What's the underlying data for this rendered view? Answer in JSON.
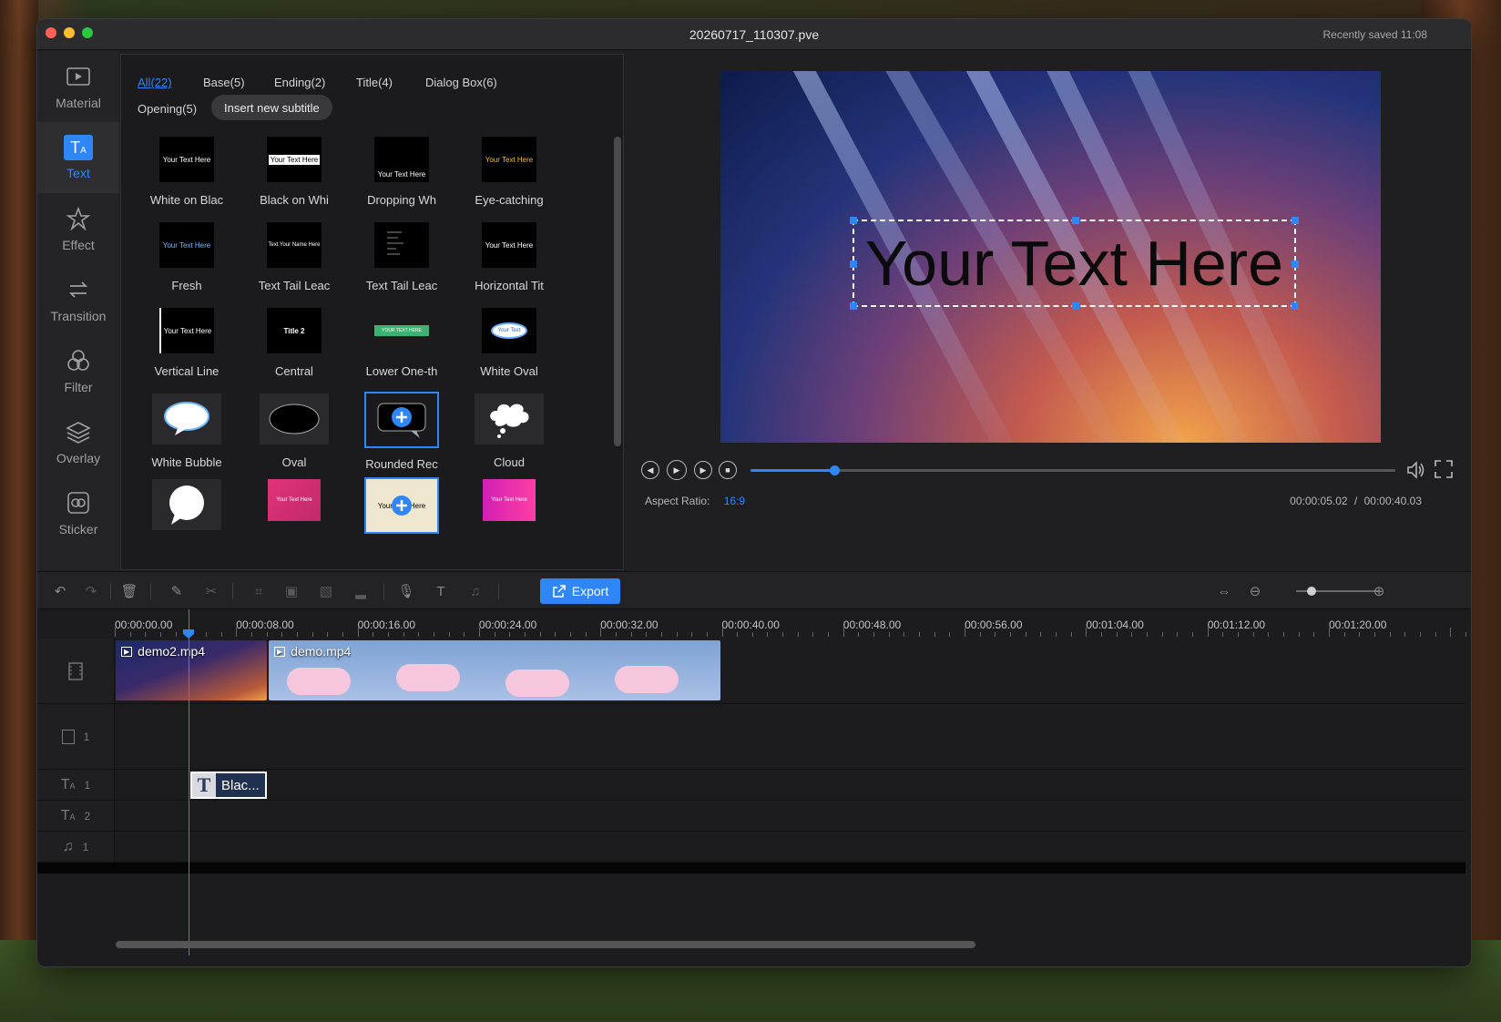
{
  "window": {
    "title": "20260717_110307.pve",
    "saved_text": "Recently saved  11:08"
  },
  "nav": [
    {
      "label": "Material",
      "icon": "material-icon"
    },
    {
      "label": "Text",
      "icon": "text-icon",
      "active": true
    },
    {
      "label": "Effect",
      "icon": "effect-icon"
    },
    {
      "label": "Transition",
      "icon": "transition-icon"
    },
    {
      "label": "Filter",
      "icon": "filter-icon"
    },
    {
      "label": "Overlay",
      "icon": "overlay-icon"
    },
    {
      "label": "Sticker",
      "icon": "sticker-icon"
    }
  ],
  "tabs": [
    {
      "label": "All(22)",
      "active": true
    },
    {
      "label": "Base(5)"
    },
    {
      "label": "Ending(2)"
    },
    {
      "label": "Title(4)"
    },
    {
      "label": "Dialog Box(6)"
    },
    {
      "label": "Opening(5)"
    }
  ],
  "insert_button": "Insert new subtitle",
  "templates": [
    {
      "label": "White on Blac",
      "thumb_text": "Your Text Here"
    },
    {
      "label": "Black on Whi",
      "thumb_text": "Your Text Here"
    },
    {
      "label": "Dropping Wh",
      "thumb_text": "Your Text Here"
    },
    {
      "label": "Eye-catching",
      "thumb_text": "Your Text Here"
    },
    {
      "label": "Fresh",
      "thumb_text": "Your Text Here"
    },
    {
      "label": "Text Tail Leac",
      "thumb_text": "Text Your Name Here"
    },
    {
      "label": "Text Tail Leac",
      "thumb_text": ""
    },
    {
      "label": "Horizontal Tit",
      "thumb_text": "Your Text Here"
    },
    {
      "label": "Vertical Line",
      "thumb_text": "Your Text Here"
    },
    {
      "label": "Central",
      "thumb_text": "Title 2"
    },
    {
      "label": "Lower One-th",
      "thumb_text": "YOUR TEXT HERE"
    },
    {
      "label": "White Oval",
      "thumb_text": "Your Text"
    },
    {
      "label": "White Bubble",
      "thumb_text": ""
    },
    {
      "label": "Oval",
      "thumb_text": ""
    },
    {
      "label": "Rounded Rec",
      "thumb_text": ""
    },
    {
      "label": "Cloud",
      "thumb_text": ""
    },
    {
      "label": "",
      "thumb_text": ""
    },
    {
      "label": "",
      "thumb_text": "Your Text Here"
    },
    {
      "label": "",
      "thumb_text": "Your Text Here"
    },
    {
      "label": "",
      "thumb_text": "Your Text Here"
    }
  ],
  "preview": {
    "overlay_text": "Your Text Here",
    "aspect_label": "Aspect Ratio:",
    "aspect_value": "16:9",
    "time_current": "00:00:05.02",
    "time_separator": "/",
    "time_total": "00:00:40.03",
    "progress_fraction": 0.13
  },
  "toolbar": {
    "export_label": "Export"
  },
  "timeline": {
    "ruler": [
      "00:00:00.00",
      "00:00:08.00",
      "00:00:16.00",
      "00:00:24.00",
      "00:00:32.00",
      "00:00:40.00",
      "00:00:48.00",
      "00:00:56.00",
      "00:01:04.00",
      "00:01:12.00",
      "00:01:20.00"
    ],
    "clips": [
      {
        "name": "demo2.mp4"
      },
      {
        "name": "demo.mp4"
      }
    ],
    "text_clip": "Blac...",
    "track_nums": [
      "1",
      "1",
      "2",
      "1"
    ]
  },
  "colors": {
    "accent": "#2f86f6",
    "bg": "#1f1f21"
  }
}
